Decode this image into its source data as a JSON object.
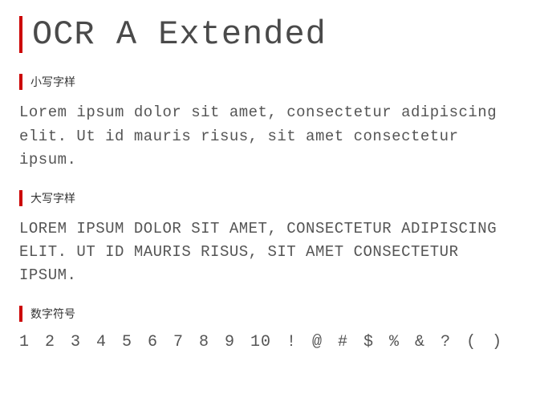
{
  "title": "OCR A Extended",
  "sections": {
    "lowercase": {
      "label": "小写字样",
      "text": "Lorem ipsum dolor sit amet, consectetur adipiscing elit. Ut id mauris risus, sit amet consectetur ipsum."
    },
    "uppercase": {
      "label": "大写字样",
      "text": "LOREM IPSUM DOLOR SIT AMET, CONSECTETUR ADIPISCING ELIT. UT ID MAURIS RISUS, SIT AMET CONSECTETUR IPSUM."
    },
    "numeric": {
      "label": "数字符号",
      "text": "1 2 3 4 5 6 7 8 9 10   ! @ # $ % & ? ( )"
    }
  }
}
